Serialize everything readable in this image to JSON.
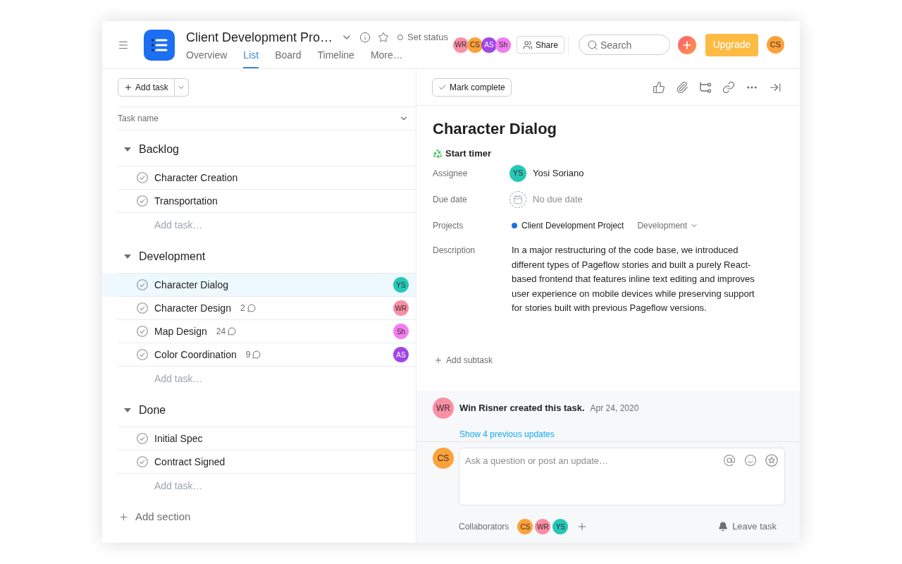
{
  "header": {
    "title": "Client Development Pro…",
    "status": "Set status",
    "tabs": [
      {
        "label": "Overview",
        "selected": false
      },
      {
        "label": "List",
        "selected": true
      },
      {
        "label": "Board",
        "selected": false
      },
      {
        "label": "Timeline",
        "selected": false
      },
      {
        "label": "More…",
        "selected": false
      }
    ],
    "members": [
      {
        "initials": "WR",
        "color": "#f98fa5"
      },
      {
        "initials": "CS",
        "color": "#fca23a"
      },
      {
        "initials": "AS",
        "color": "#9f46e4"
      },
      {
        "initials": "Sh",
        "color": "#f27df1"
      }
    ],
    "share": "Share",
    "search": {
      "placeholder": "Search"
    },
    "upgrade": "Upgrade",
    "user": {
      "initials": "CS",
      "color": "#fca23a"
    }
  },
  "list": {
    "add_task": "Add task",
    "column": "Task name",
    "sections": [
      {
        "title": "Backlog",
        "expanded": true,
        "tasks": [
          {
            "name": "Character Creation",
            "completed": false,
            "selected": false
          },
          {
            "name": "Transportation",
            "completed": false,
            "selected": false
          }
        ],
        "add_task": "Add task…"
      },
      {
        "title": "Development",
        "expanded": true,
        "tasks": [
          {
            "name": "Character Dialog",
            "completed": false,
            "selected": true,
            "assignee": {
              "initials": "YS",
              "color": "#25c8b6"
            }
          },
          {
            "name": "Character Design",
            "completed": false,
            "selected": false,
            "comments": "2",
            "assignee": {
              "initials": "WR",
              "color": "#f98fa5"
            }
          },
          {
            "name": "Map Design",
            "completed": false,
            "selected": false,
            "comments": "24",
            "assignee": {
              "initials": "Sh",
              "color": "#f27df1"
            }
          },
          {
            "name": "Color Coordination",
            "completed": false,
            "selected": false,
            "comments": "9",
            "assignee": {
              "initials": "AS",
              "color": "#9f46e4"
            }
          }
        ],
        "add_task": "Add task…"
      },
      {
        "title": "Done",
        "expanded": true,
        "tasks": [
          {
            "name": "Initial Spec",
            "completed": false,
            "selected": false
          },
          {
            "name": "Contract Signed",
            "completed": false,
            "selected": false
          }
        ],
        "add_task": "Add task…"
      }
    ],
    "add_section": "Add section"
  },
  "detail": {
    "mark_complete": "Mark complete",
    "title": "Character Dialog",
    "timer": "Start timer",
    "fields": [
      {
        "kind": "person",
        "label": "Assignee",
        "person": {
          "initials": "YS",
          "color": "#25c8b6"
        },
        "value": "Yosi Soriano"
      },
      {
        "kind": "date",
        "label": "Due date",
        "value": "No due date"
      },
      {
        "kind": "project",
        "label": "Projects",
        "value": "Client Development Project",
        "section": "Development"
      },
      {
        "kind": "text",
        "label": "Description",
        "value": "In a major restructuring of the code base, we introduced different types of Pageflow stories and built a purely React-based frontend that features inline text editing and improves user experience on mobile devices while preserving support for stories built with previous Pageflow versions."
      }
    ],
    "add_subtask": "Add subtask",
    "activity": {
      "author": {
        "initials": "WR",
        "color": "#f98fa5"
      },
      "text": "Win Risner created this task.",
      "date": "Apr 24, 2020"
    },
    "show_updates": "Show 4 previous updates",
    "composer": {
      "author": {
        "initials": "CS",
        "color": "#fca23a"
      },
      "placeholder": "Ask a question or post an update…"
    },
    "collaborators": {
      "label": "Collaborators",
      "people": [
        {
          "initials": "CS",
          "color": "#fca23a"
        },
        {
          "initials": "WR",
          "color": "#f98fa5"
        },
        {
          "initials": "YS",
          "color": "#25c8b6"
        }
      ]
    },
    "leave": "Leave task"
  }
}
